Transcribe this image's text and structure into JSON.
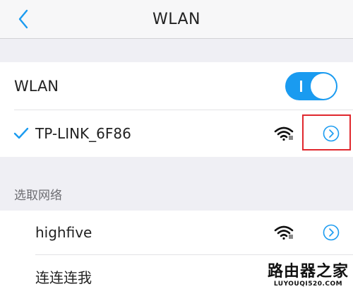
{
  "nav": {
    "title": "WLAN",
    "back_icon": "chevron-left-icon"
  },
  "wlan_toggle": {
    "label": "WLAN",
    "state": "on",
    "accent": "#1a9bf0"
  },
  "connected_network": {
    "name": "TP-LINK_6F86",
    "connected": true,
    "secured": true
  },
  "section_header": "选取网络",
  "networks": [
    {
      "name": "highfive",
      "secured": true
    },
    {
      "name": "连连连我",
      "secured": true
    }
  ],
  "highlight_color": "#e0282e",
  "watermark": {
    "text": "路由器之家",
    "url": "LUYOUQI520.COM"
  }
}
